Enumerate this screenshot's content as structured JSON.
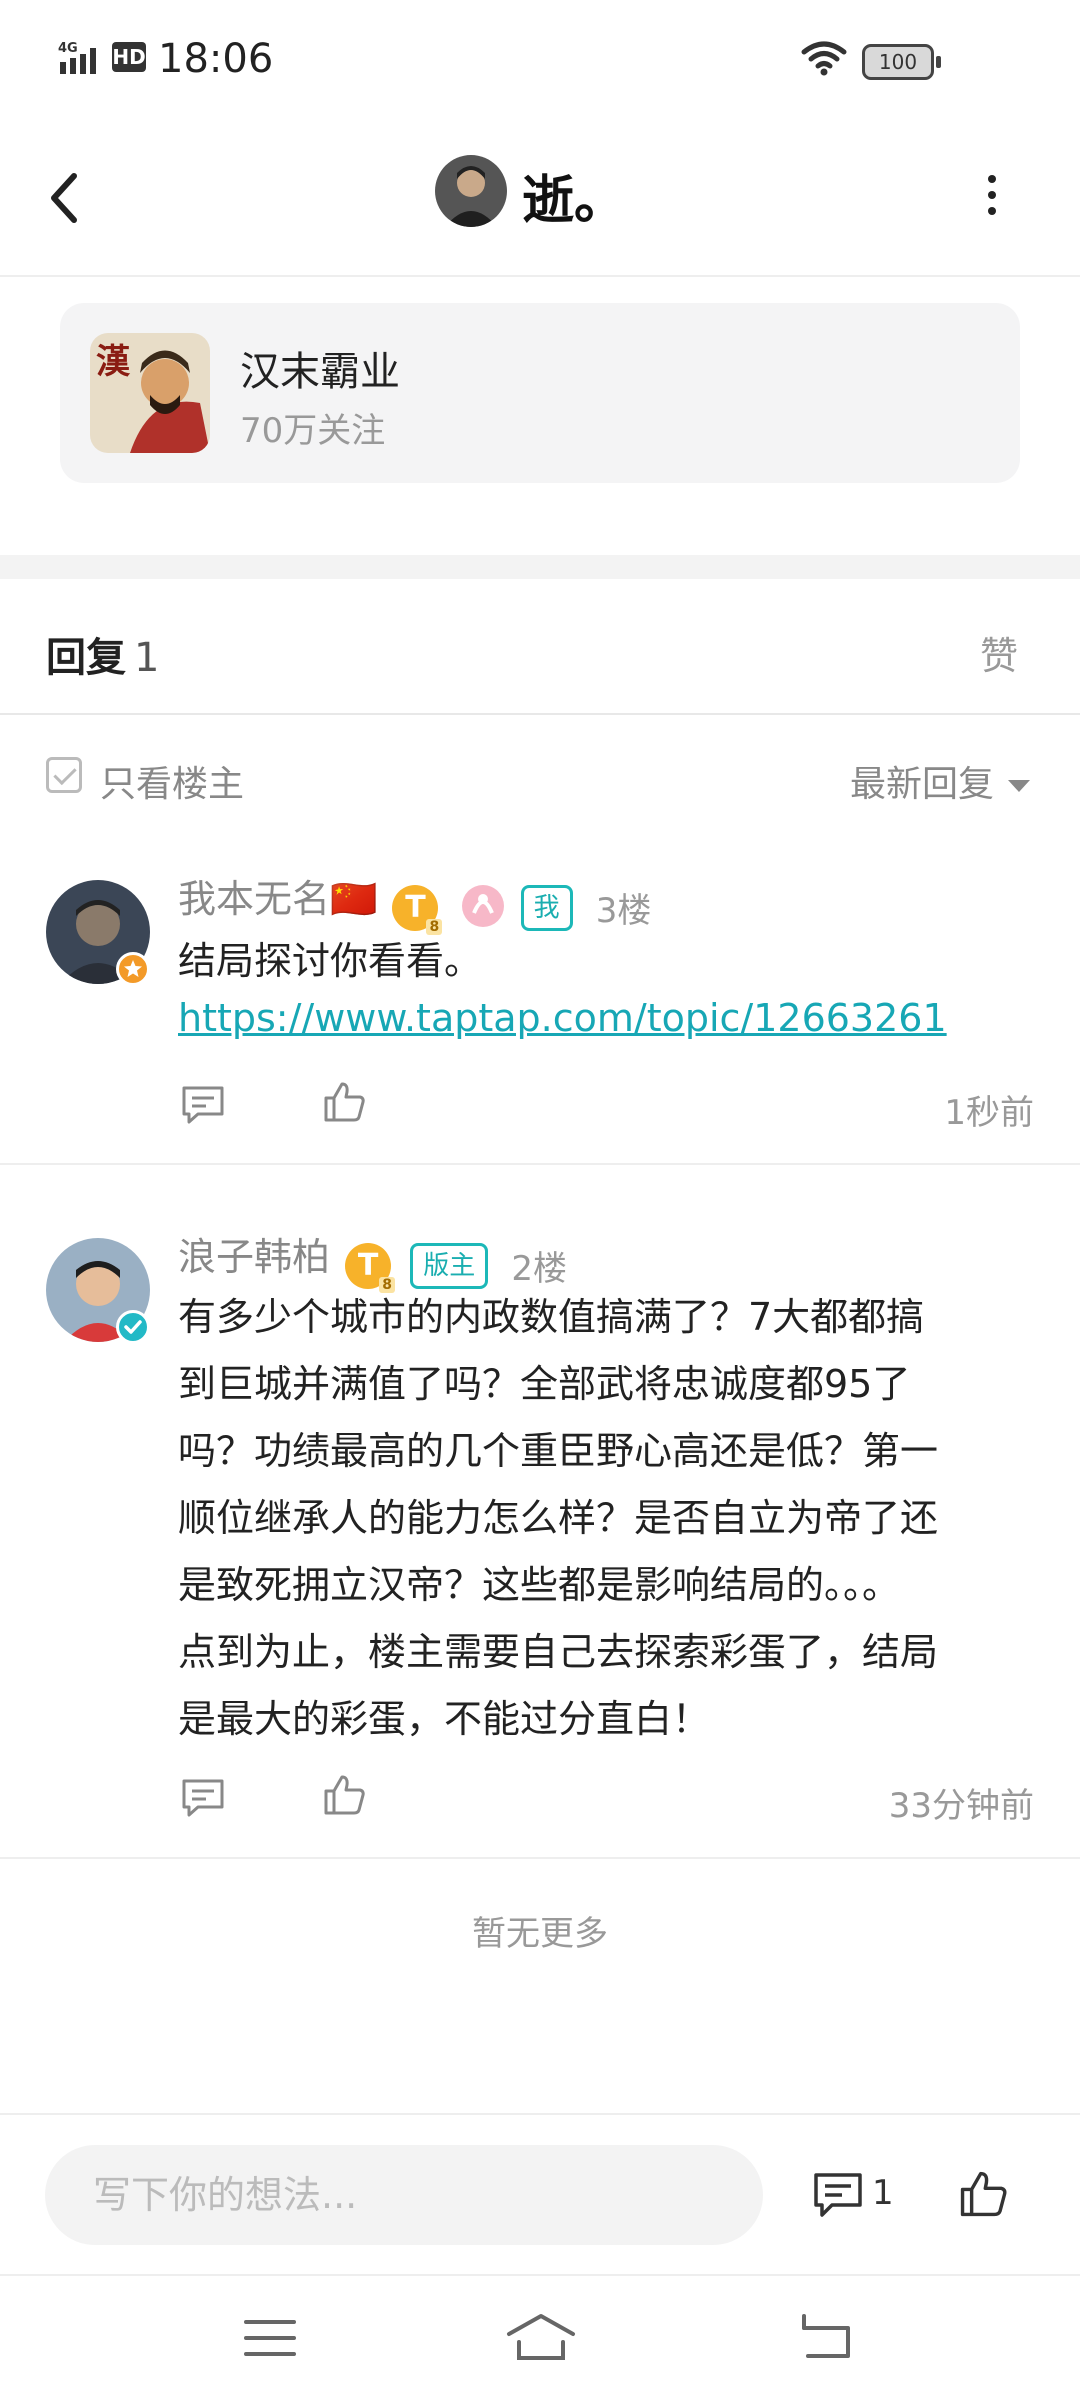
{
  "status_bar": {
    "time": "18:06",
    "network": "4G",
    "hd_label": "HD",
    "battery": "100"
  },
  "header": {
    "title": "逝。"
  },
  "forum": {
    "name": "汉末霸业",
    "followers": "70万关注",
    "icon_char": "漢"
  },
  "tabs": {
    "reply_label": "回复",
    "reply_count": "1",
    "like_label": "赞"
  },
  "filter": {
    "only_op": "只看楼主",
    "sort": "最新回复"
  },
  "comments": [
    {
      "user": "我本无名🇨🇳",
      "coin": "T",
      "tag": "我",
      "floor": "3楼",
      "text": "结局探讨你看看。",
      "link": "https://www.taptap.com/topic/12663261",
      "time": "1秒前"
    },
    {
      "user": "浪子韩柏",
      "coin": "T",
      "tag": "版主",
      "floor": "2楼",
      "lines": [
        "有多少个城市的内政数值搞满了？7大都都搞",
        "到巨城并满值了吗？全部武将忠诚度都95了",
        "吗？功绩最高的几个重臣野心高还是低？第一",
        "顺位继承人的能力怎么样？是否自立为帝了还",
        "是致死拥立汉帝？这些都是影响结局的。。。",
        "点到为止，楼主需要自己去探索彩蛋了，结局",
        "是最大的彩蛋，不能过分直白！"
      ],
      "time": "33分钟前"
    }
  ],
  "no_more": "暂无更多",
  "composer": {
    "placeholder": "写下你的想法...",
    "comment_count": "1"
  },
  "colors": {
    "accent_teal": "#17a7b5",
    "coin_gold": "#f7b22a",
    "muted_gray": "#999999"
  }
}
